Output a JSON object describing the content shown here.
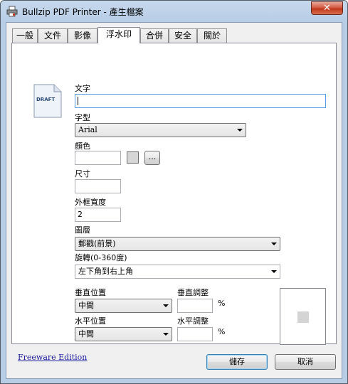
{
  "window": {
    "title": "Bullzip PDF Printer - 產生檔案",
    "close_label": "✕"
  },
  "tabs": [
    {
      "label": "一般"
    },
    {
      "label": "文件"
    },
    {
      "label": "影像"
    },
    {
      "label": "浮水印"
    },
    {
      "label": "合併"
    },
    {
      "label": "安全"
    },
    {
      "label": "關於"
    }
  ],
  "active_tab": "浮水印",
  "watermark": {
    "icon_text": "DRAFT",
    "text_label": "文字",
    "text_value": "",
    "font_label": "字型",
    "font_value": "Arial",
    "color_label": "顏色",
    "color_value": "",
    "color_button_label": "...",
    "size_label": "尺寸",
    "size_value": "",
    "outline_label": "外框寬度",
    "outline_value": "2",
    "layer_label": "圖層",
    "layer_value": "郵戳(前景)",
    "rotation_label": "旋轉(0-360度)",
    "rotation_value": "左下角到右上角",
    "vpos_label": "垂直位置",
    "vpos_value": "中間",
    "vadjust_label": "垂直調整",
    "vadjust_value": "",
    "vadjust_unit": "%",
    "hpos_label": "水平位置",
    "hpos_value": "中間",
    "hadjust_label": "水平調整",
    "hadjust_value": "",
    "hadjust_unit": "%"
  },
  "footer": {
    "edition_link": "Freeware Edition",
    "save_label": "儲存",
    "cancel_label": "取消"
  }
}
